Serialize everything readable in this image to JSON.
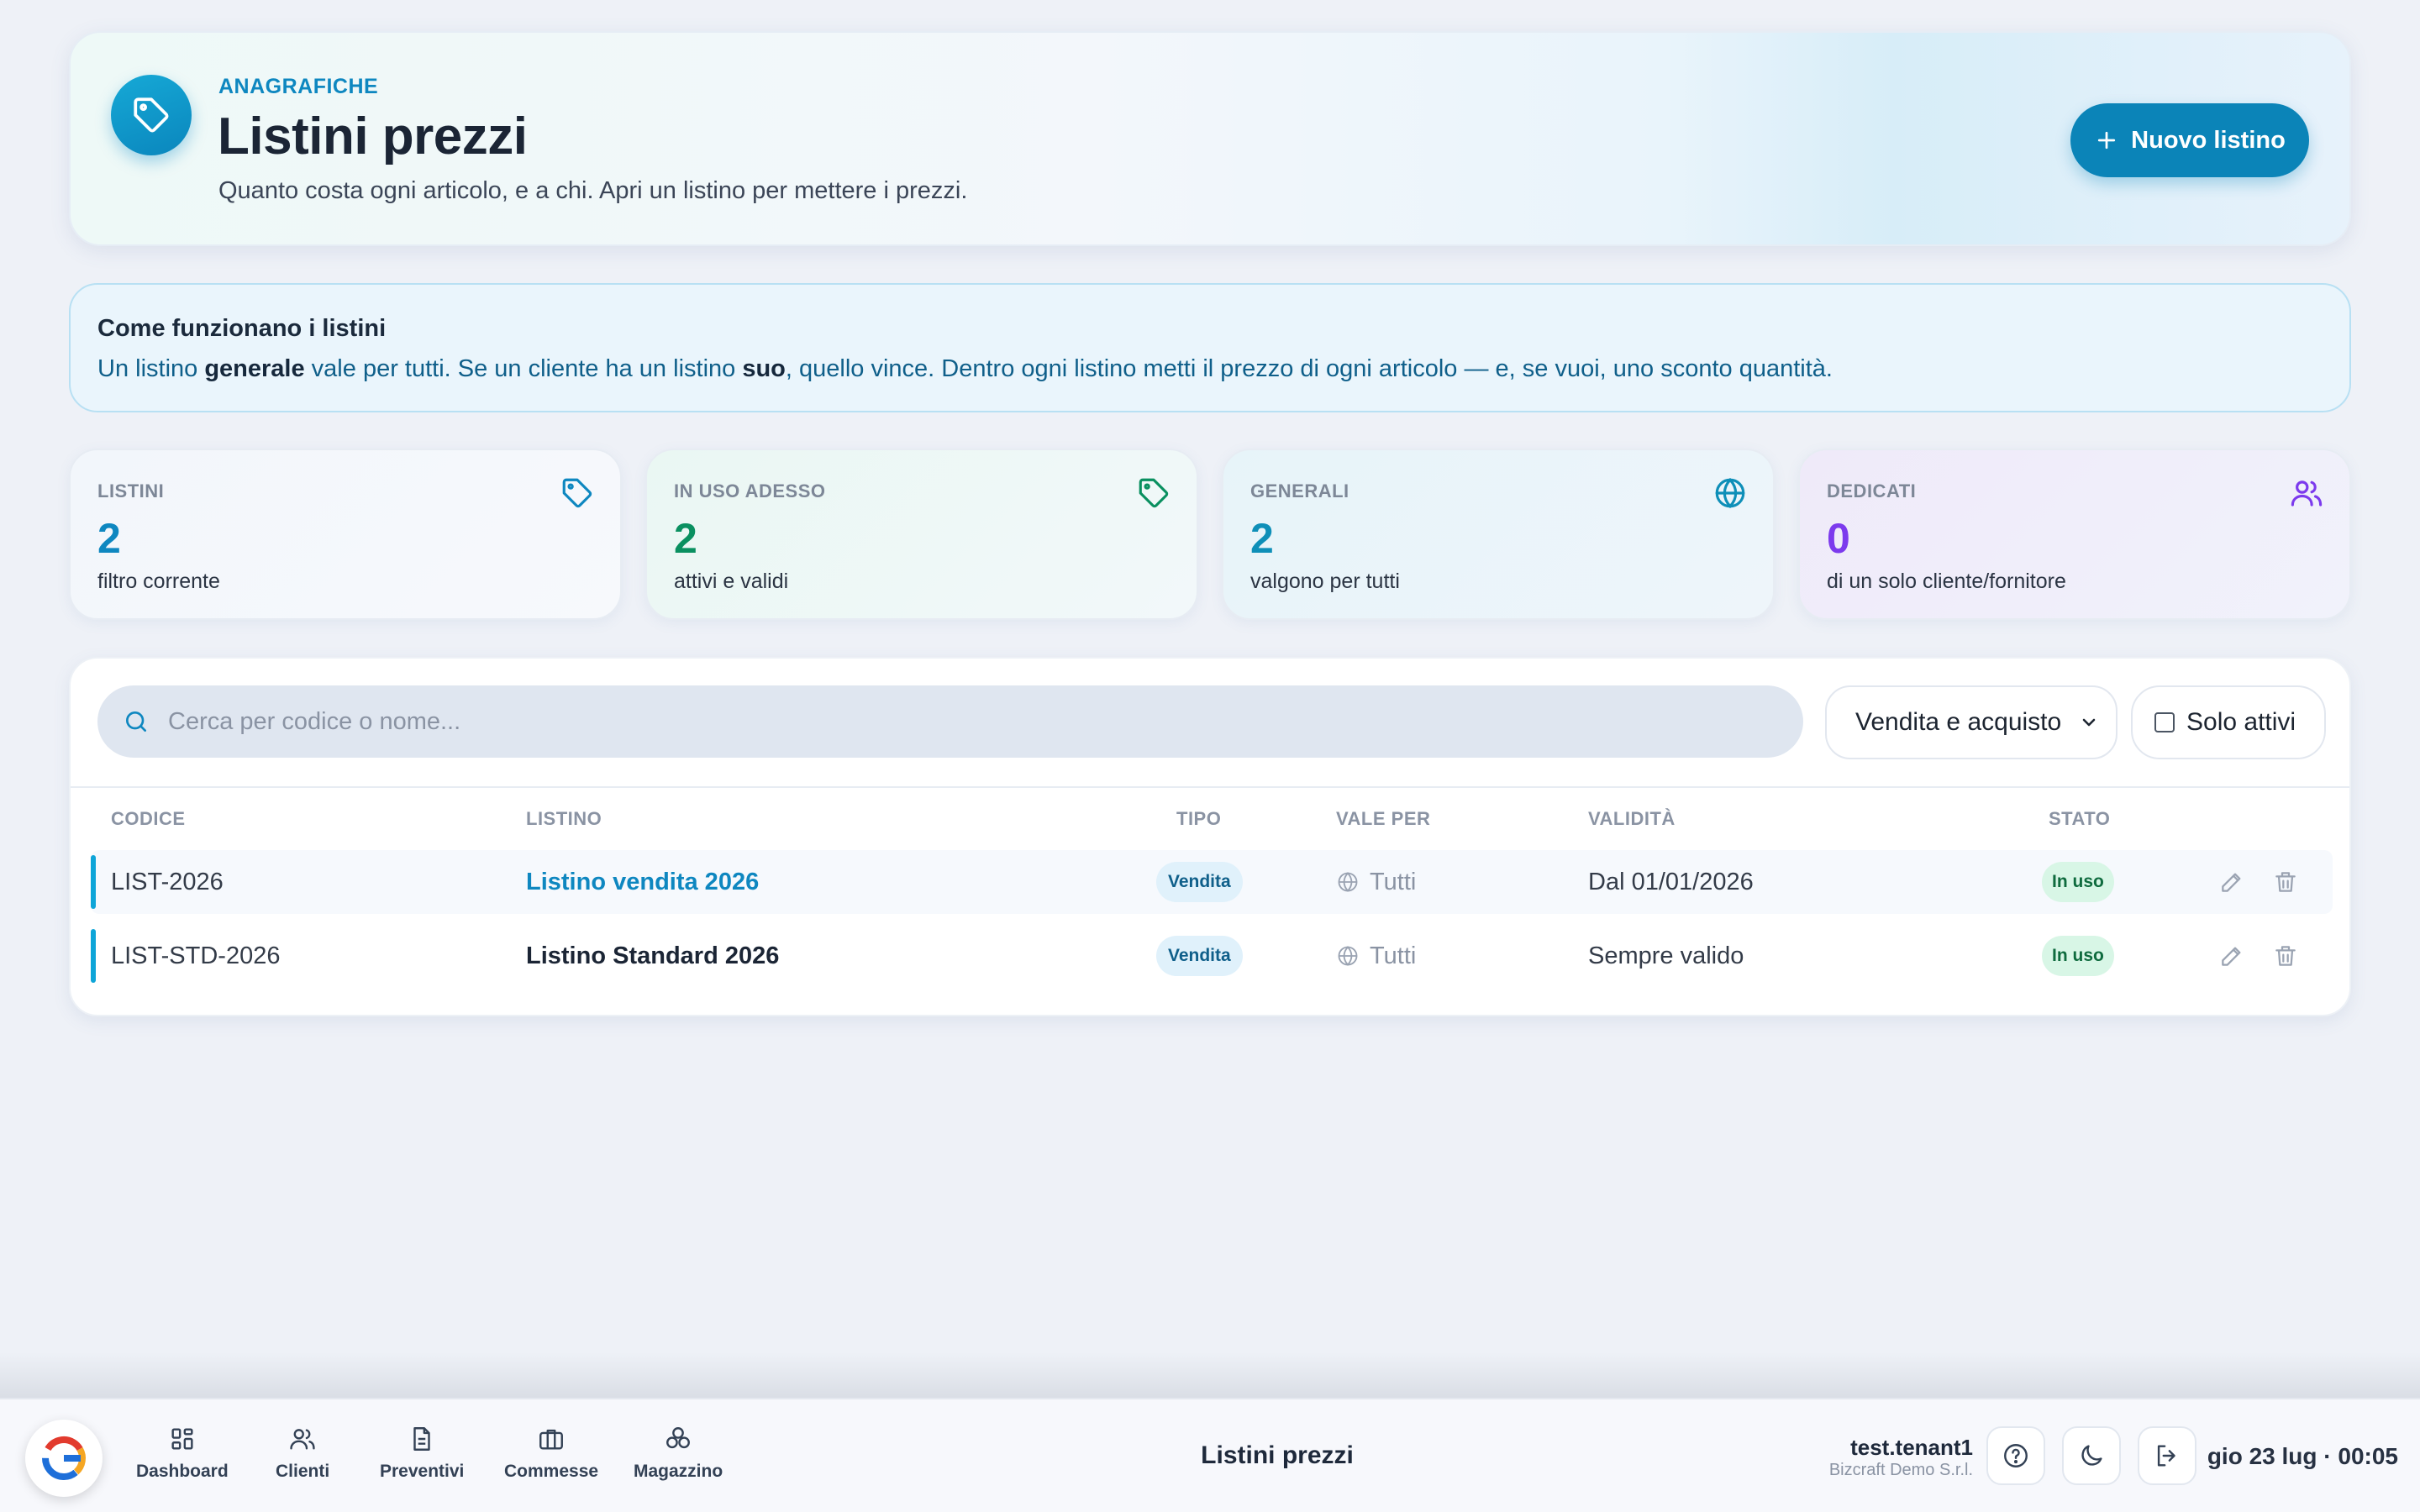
{
  "header": {
    "kicker": "ANAGRAFICHE",
    "title": "Listini prezzi",
    "subtitle": "Quanto costa ogni articolo, e a chi. Apri un listino per mettere i prezzi.",
    "new_button": "Nuovo listino"
  },
  "info": {
    "title": "Come funzionano i listini",
    "text_1": "Un listino ",
    "bold_1": "generale",
    "text_2": " vale per tutti. Se un cliente ha un listino ",
    "bold_2": "suo",
    "text_3": ", quello vince. Dentro ogni listino metti il prezzo di ogni articolo — e, se vuoi, uno sconto quantità."
  },
  "stats": [
    {
      "label": "LISTINI",
      "value": "2",
      "note": "filtro corrente",
      "color": "#0e87c0",
      "icon": "tag-icon"
    },
    {
      "label": "IN USO ADESSO",
      "value": "2",
      "note": "attivi e validi",
      "color": "#0a9060",
      "icon": "tag-icon"
    },
    {
      "label": "GENERALI",
      "value": "2",
      "note": "valgono per tutti",
      "color": "#0e8fb8",
      "icon": "globe-icon"
    },
    {
      "label": "DEDICATI",
      "value": "0",
      "note": "di un solo cliente/fornitore",
      "color": "#7c3aed",
      "icon": "users-icon"
    }
  ],
  "filters": {
    "search_placeholder": "Cerca per codice o nome...",
    "type_select": "Vendita e acquisto",
    "only_active": "Solo attivi"
  },
  "table": {
    "columns": {
      "code": "CODICE",
      "name": "LISTINO",
      "type": "TIPO",
      "applies": "VALE PER",
      "validity": "VALIDITÀ",
      "state": "STATO"
    },
    "rows": [
      {
        "code": "LIST-2026",
        "name": "Listino vendita 2026",
        "type": "Vendita",
        "applies": "Tutti",
        "validity": "Dal 01/01/2026",
        "state": "In uso"
      },
      {
        "code": "LIST-STD-2026",
        "name": "Listino Standard 2026",
        "type": "Vendita",
        "applies": "Tutti",
        "validity": "Sempre valido",
        "state": "In uso"
      }
    ]
  },
  "nav": {
    "items": [
      {
        "label": "Dashboard",
        "icon": "grid-icon"
      },
      {
        "label": "Clienti",
        "icon": "users-icon"
      },
      {
        "label": "Preventivi",
        "icon": "document-icon"
      },
      {
        "label": "Commesse",
        "icon": "briefcase-icon"
      },
      {
        "label": "Magazzino",
        "icon": "boxes-icon"
      }
    ],
    "page_title": "Listini prezzi",
    "user_name": "test.tenant1",
    "org_name": "Bizcraft Demo S.r.l.",
    "datetime": "gio 23 lug · 00:05"
  },
  "colors": {
    "accent": "#0b84b8",
    "success": "#0a9060",
    "violet": "#7c3aed"
  }
}
